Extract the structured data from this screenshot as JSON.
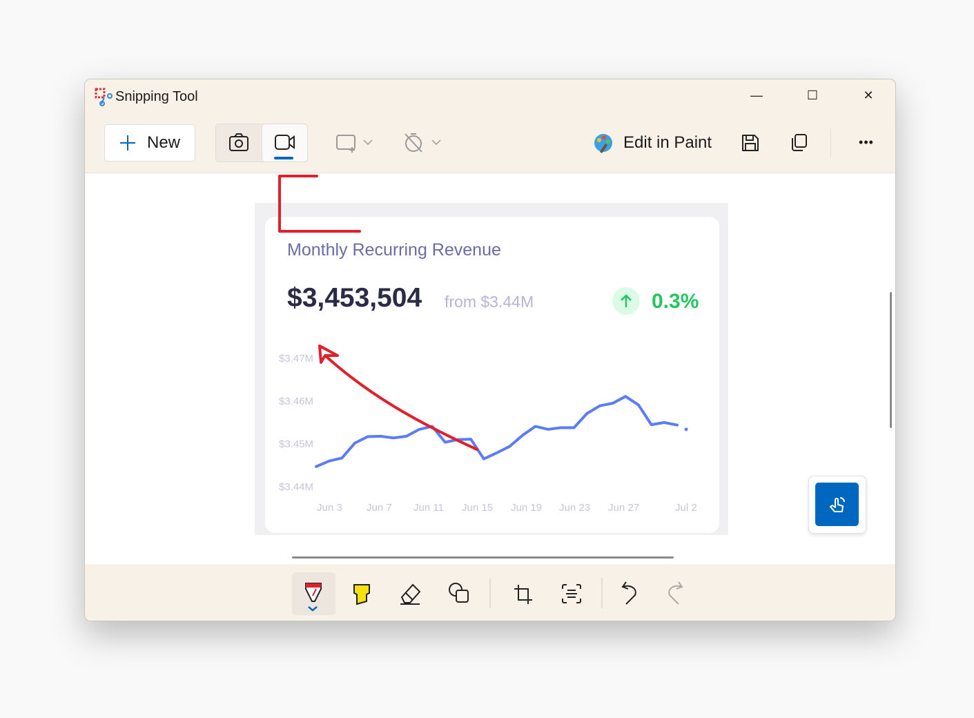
{
  "window": {
    "title": "Snipping Tool",
    "minimize": "—",
    "maximize": "☐",
    "close": "✕"
  },
  "toolbar": {
    "new_label": "New",
    "edit_in_paint": "Edit in Paint",
    "more": "•••",
    "icons": [
      "plus-icon",
      "camera-icon",
      "video-icon",
      "rectangle-mode-icon",
      "timer-off-icon",
      "paint-icon",
      "save-icon",
      "copy-icon",
      "more-icon"
    ],
    "active_mode": "video"
  },
  "captured": {
    "title": "Monthly Recurring Revenue",
    "value": "$3,453,504",
    "from": "from $3.44M",
    "change": "0.3%",
    "change_color": "#22c55e",
    "line_color": "#5b7cfa",
    "annotation_color": "#e0202a",
    "y_ticks": [
      "$3.47M",
      "$3.46M",
      "$3.45M",
      "$3.44M"
    ],
    "x_ticks": [
      "Jun 3",
      "Jun 7",
      "Jun 11",
      "Jun 15",
      "Jun 19",
      "Jun 23",
      "Jun 27",
      "Jul 2"
    ],
    "y_range_millions": [
      3.44,
      3.47
    ],
    "values_millions": [
      3.4447,
      3.446,
      3.4467,
      3.4502,
      3.4517,
      3.4518,
      3.4514,
      3.4518,
      3.4534,
      3.4541,
      3.4504,
      3.451,
      3.4511,
      3.4465,
      3.4479,
      3.4494,
      3.452,
      3.4541,
      3.4534,
      3.4538,
      3.4538,
      3.4571,
      3.4589,
      3.4595,
      3.4611,
      3.4591,
      3.4545,
      3.455,
      3.4544
    ],
    "last_value_millions": 3.4534
  },
  "markup_tools": [
    "ballpoint-pen",
    "highlighter",
    "eraser",
    "shapes",
    "crop",
    "text-actions",
    "undo",
    "redo"
  ],
  "selected_tool": "ballpoint-pen"
}
